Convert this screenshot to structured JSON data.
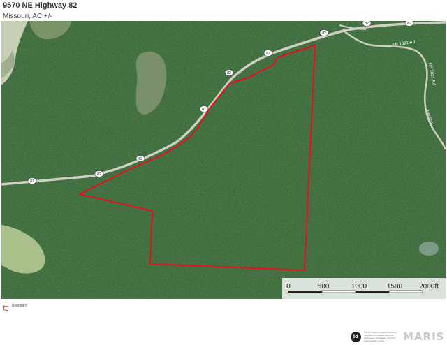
{
  "header": {
    "title": "9570 NE Highway 82",
    "subtitle": "Missouri,  AC +/-"
  },
  "map": {
    "road_shields": [
      "82",
      "82",
      "82",
      "82",
      "82",
      "82",
      "82",
      "82",
      "82"
    ],
    "road_labels": [
      "NE 1021 Rd",
      "NE 1021 Rd",
      "Neosho..."
    ],
    "boundary_color": "#e8111b",
    "scale_bar": {
      "ticks": [
        "0",
        "500",
        "1000",
        "1500",
        "2000ft"
      ]
    }
  },
  "legend": {
    "label": "Boundary",
    "color": "#b44a3e"
  },
  "footer": {
    "badge_text": "id",
    "disclaimer": "The information contained herein is believed to be reliable but is not guaranteed. Information should be independently verified.",
    "logo_text": "MARIS"
  }
}
